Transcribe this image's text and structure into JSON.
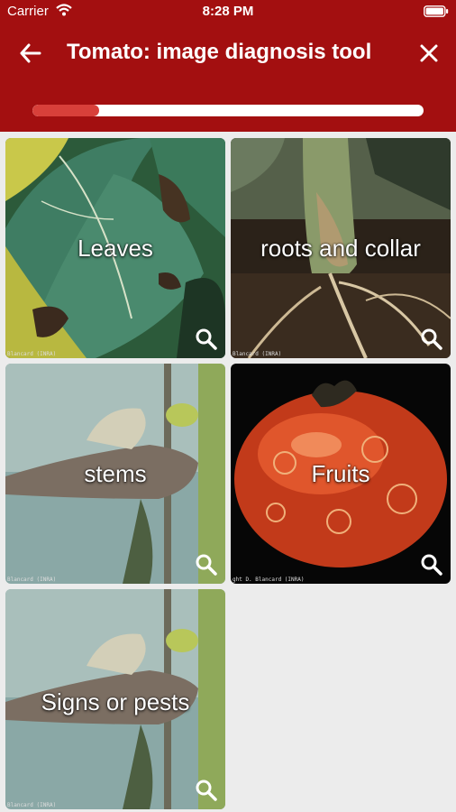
{
  "status_bar": {
    "carrier": "Carrier",
    "time": "8:28 PM"
  },
  "header": {
    "title": "Tomato: image diagnosis tool"
  },
  "progress": {
    "fraction": 0.17
  },
  "colors": {
    "header": "#a30f10",
    "progress_fill": "#d8403a",
    "background": "#ececec"
  },
  "icons": {
    "back": "arrow-left-icon",
    "close": "close-icon",
    "zoom": "magnifier-icon"
  },
  "tiles": [
    {
      "label": "Leaves",
      "credit": "Blancard (INRA)"
    },
    {
      "label": "roots and collar",
      "credit": "Blancard (INRA)"
    },
    {
      "label": "stems",
      "credit": "Blancard (INRA)"
    },
    {
      "label": "Fruits",
      "credit": "ght D. Blancard (INRA)"
    },
    {
      "label": "Signs or pests",
      "credit": "Blancard (INRA)"
    }
  ]
}
